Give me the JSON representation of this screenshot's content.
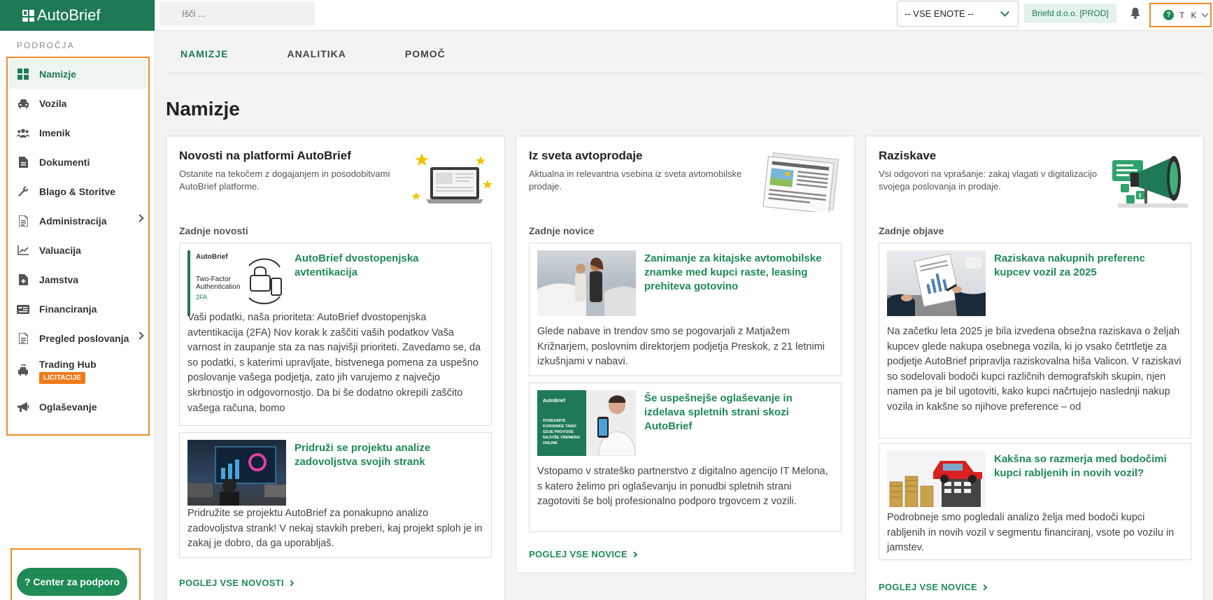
{
  "app": {
    "logo_text": "AutoBrief"
  },
  "search": {
    "placeholder": "Išči ..."
  },
  "topbar": {
    "unit_select": "-- VSE ENOTE --",
    "company": "Briefd d.o.o. [PROD]",
    "user_initials": "T K"
  },
  "sidebar": {
    "section_label": "PODROČJA",
    "items": [
      {
        "label": "Namizje",
        "icon": "dashboard-icon"
      },
      {
        "label": "Vozila",
        "icon": "car-icon"
      },
      {
        "label": "Imenik",
        "icon": "users-icon"
      },
      {
        "label": "Dokumenti",
        "icon": "document-icon"
      },
      {
        "label": "Blago & Storitve",
        "icon": "wrench-icon"
      },
      {
        "label": "Administracija",
        "icon": "file-icon"
      },
      {
        "label": "Valuacija",
        "icon": "chart-icon"
      },
      {
        "label": "Jamstva",
        "icon": "warranty-icon"
      },
      {
        "label": "Financiranja",
        "icon": "finance-icon"
      },
      {
        "label": "Pregled poslovanja",
        "icon": "report-icon"
      },
      {
        "label": "Trading Hub",
        "icon": "trading-icon",
        "badge": "LICITACIJE"
      },
      {
        "label": "Oglaševanje",
        "icon": "megaphone-icon"
      }
    ],
    "support_label": "? Center za podporo"
  },
  "tabs": [
    {
      "label": "NAMIZJE"
    },
    {
      "label": "ANALITIKA"
    },
    {
      "label": "POMOČ"
    }
  ],
  "page_title": "Namizje",
  "cards": [
    {
      "title": "Novosti na platformi AutoBrief",
      "subtitle": "Ostanite na tekočem z dogajanjem in posodobitvami AutoBrief platforme.",
      "section_label": "Zadnje novosti",
      "articles": [
        {
          "title": "AutoBrief dvostopenjska avtentikacija",
          "thumb_text": {
            "brand": "AutoBrief",
            "line1": "Two-Factor",
            "line2": "Authentication",
            "tag": "2FA"
          },
          "body": "Vaši podatki, naša prioriteta: AutoBrief dvostopenjska avtentikacija (2FA)  Nov korak k zaščiti vaših podatkov Vaša varnost in zaupanje sta za nas najvišji prioriteti. Zavedamo se, da so podatki, s katerimi upravljate, bistvenega pomena za uspešno poslovanje vašega podjetja, zato jih varujemo z največjo skrbnostjo in odgovornostjo. Da bi še dodatno okrepili zaščito vašega računa, bomo"
        },
        {
          "title": "Pridruži se projektu analize zadovoljstva svojih strank",
          "body": "Pridružite se projektu AutoBrief za ponakupno analizo zadovoljstva strank! V nekaj stavkih preberi, kaj projekt sploh je in zakaj je dobro, da ga uporabljaš."
        }
      ],
      "more_label": "POGLEJ VSE NOVOSTI"
    },
    {
      "title": "Iz sveta avtoprodaje",
      "subtitle": "Aktualna in relevantna vsebina iz sveta avtomobilske prodaje.",
      "section_label": "Zadnje novice",
      "articles": [
        {
          "title": "Zanimanje za kitajske avtomobilske znamke med kupci raste, leasing prehiteva gotovino",
          "body": "Glede nabave in trendov smo se pogovarjali z Matjažem Križnarjem, poslovnim direktorjem podjetja Preskok, z 21 letnimi izkušnjami v nabavi."
        },
        {
          "title": "Še uspešnejše oglaševanje in izdelava spletnih strani skozi AutoBrief",
          "thumb_text": {
            "brand": "AutoBrief",
            "line1": "DOSEGNITE",
            "line2": "KORISNIKE TAMO",
            "line3": "GDJE PROVODE",
            "line4": "NAJVIŠE VREMENA:",
            "line5": "ONLINE"
          },
          "body": "Vstopamo v strateško partnerstvo z digitalno agencijo IT Melona, s katero želimo pri oglaševanju in ponudbi spletnih strani zagotoviti še bolj profesionalno podporo trgovcem z vozili."
        }
      ],
      "more_label": "POGLEJ VSE NOVICE"
    },
    {
      "title": "Raziskave",
      "subtitle": "Vsi odgovori na vprašanje: zakaj vlagati v digitalizacijo svojega poslovanja in prodaje.",
      "section_label": "Zadnje objave",
      "articles": [
        {
          "title": "Raziskava nakupnih preferenc kupcev vozil za 2025",
          "body": "Na začetku leta 2025 je bila izvedena obsežna raziskava o željah kupcev glede nakupa osebnega vozila, ki jo vsako četrtletje za podjetje AutoBrief pripravlja raziskovalna hiša Valicon. V raziskavi so sodelovali bodoči kupci različnih demografskih skupin, njen namen pa je bil ugotoviti, kako kupci načrtujejo naslednji nakup vozila in kakšne so njihove preference – od"
        },
        {
          "title": "Kakšna so razmerja med bodočimi kupci rabljenih in novih vozil?",
          "body": "Podrobneje smo pogledali analizo želja med bodoči kupci rabljenih in novih vozil v segmentu financiranj, vsote po vozilu in jamstev."
        }
      ],
      "more_label": "POGLEJ VSE NOVICE"
    }
  ],
  "colors": {
    "brand": "#1e7a55",
    "accent_green": "#1e8a55",
    "highlight": "#f08a24",
    "badge": "#f07a1a"
  }
}
